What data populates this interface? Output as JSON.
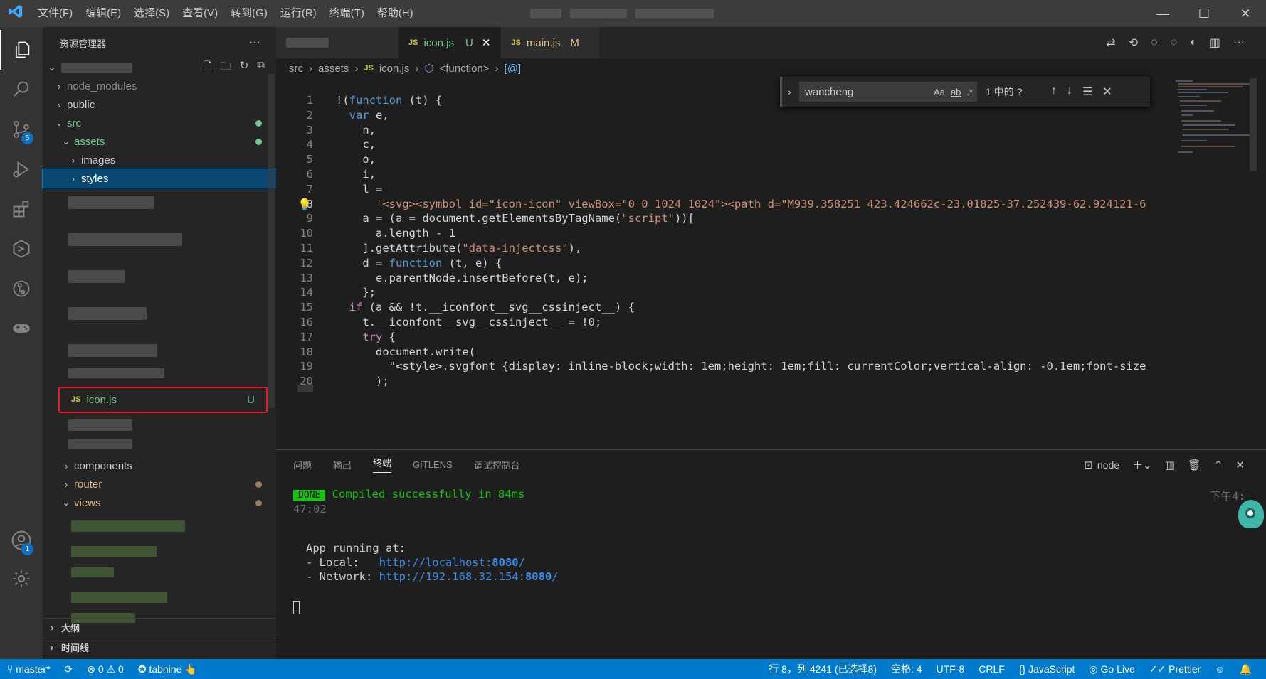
{
  "menu": [
    "文件(F)",
    "编辑(E)",
    "选择(S)",
    "查看(V)",
    "转到(G)",
    "运行(R)",
    "终端(T)",
    "帮助(H)"
  ],
  "activity": {
    "source_control_badge": "5",
    "account_badge": "1"
  },
  "sidebar": {
    "title": "资源管理器",
    "more": "···",
    "tree": {
      "node_modules": "node_modules",
      "public": "public",
      "src": "src",
      "assets": "assets",
      "images": "images",
      "styles": "styles",
      "icon_file": "icon.js",
      "icon_status": "U",
      "components": "components",
      "router": "router",
      "views": "views"
    },
    "outline": "大纲",
    "timeline": "时间线"
  },
  "tabs": [
    {
      "label": "icon.js",
      "status": "U"
    },
    {
      "label": "main.js",
      "status": "M"
    }
  ],
  "breadcrumb": [
    "src",
    "assets",
    "icon.js",
    "<function>",
    "[@]"
  ],
  "find": {
    "query": "wancheng",
    "opt_case": "Aa",
    "opt_word": "ab",
    "opt_regex": ".*",
    "result": "1 中的 ?"
  },
  "code": {
    "line_numbers": [
      "1",
      "2",
      "3",
      "4",
      "5",
      "6",
      "7",
      "8",
      "9",
      "10",
      "11",
      "12",
      "13",
      "14",
      "15",
      "16",
      "17",
      "18",
      "19",
      "20"
    ],
    "lines": [
      "!(function (t) {",
      "  var e,",
      "    n,",
      "    c,",
      "    o,",
      "    i,",
      "    l =",
      "      '<svg><symbol id=\"icon-icon\" viewBox=\"0 0 1024 1024\"><path d=\"M939.358251 423.424662c-23.01825-37.252439-62.924121-6",
      "    a = (a = document.getElementsByTagName(\"script\"))[",
      "      a.length - 1",
      "    ].getAttribute(\"data-injectcss\"),",
      "    d = function (t, e) {",
      "      e.parentNode.insertBefore(t, e);",
      "    };",
      "  if (a && !t.__iconfont__svg__cssinject__) {",
      "    t.__iconfont__svg__cssinject__ = !0;",
      "    try {",
      "      document.write(",
      "        \"<style>.svgfont {display: inline-block;width: 1em;height: 1em;fill: currentColor;vertical-align: -0.1em;font-size",
      "      );"
    ]
  },
  "panel": {
    "tabs": [
      "问题",
      "输出",
      "终端",
      "GITLENS",
      "调试控制台"
    ],
    "active": "终端",
    "shell": "node",
    "done": "DONE",
    "compiled": "Compiled successfully in 84ms",
    "time_right": "下午4:",
    "time_left": "47:02",
    "app_running": "App running at:",
    "local_label": "- Local:   ",
    "local_url": "http://localhost:",
    "local_port": "8080",
    "local_tail": "/",
    "network_label": "- Network: ",
    "network_url": "http://192.168.32.154:",
    "network_port": "8080",
    "network_tail": "/"
  },
  "status": {
    "branch": "master*",
    "errors": "0",
    "warnings": "0",
    "tabnine": "tabnine",
    "position": "行 8，列 4241 (已选择8)",
    "spaces": "空格: 4",
    "encoding": "UTF-8",
    "eol": "CRLF",
    "language": "JavaScript",
    "golive": "Go Live",
    "prettier": "Prettier"
  },
  "colors": {
    "statusbar": "#007acc",
    "activity": "#333333",
    "sidebar": "#252526",
    "editor": "#1e1e1e",
    "selected": "#094771",
    "highlight_box": "#e51c23"
  }
}
